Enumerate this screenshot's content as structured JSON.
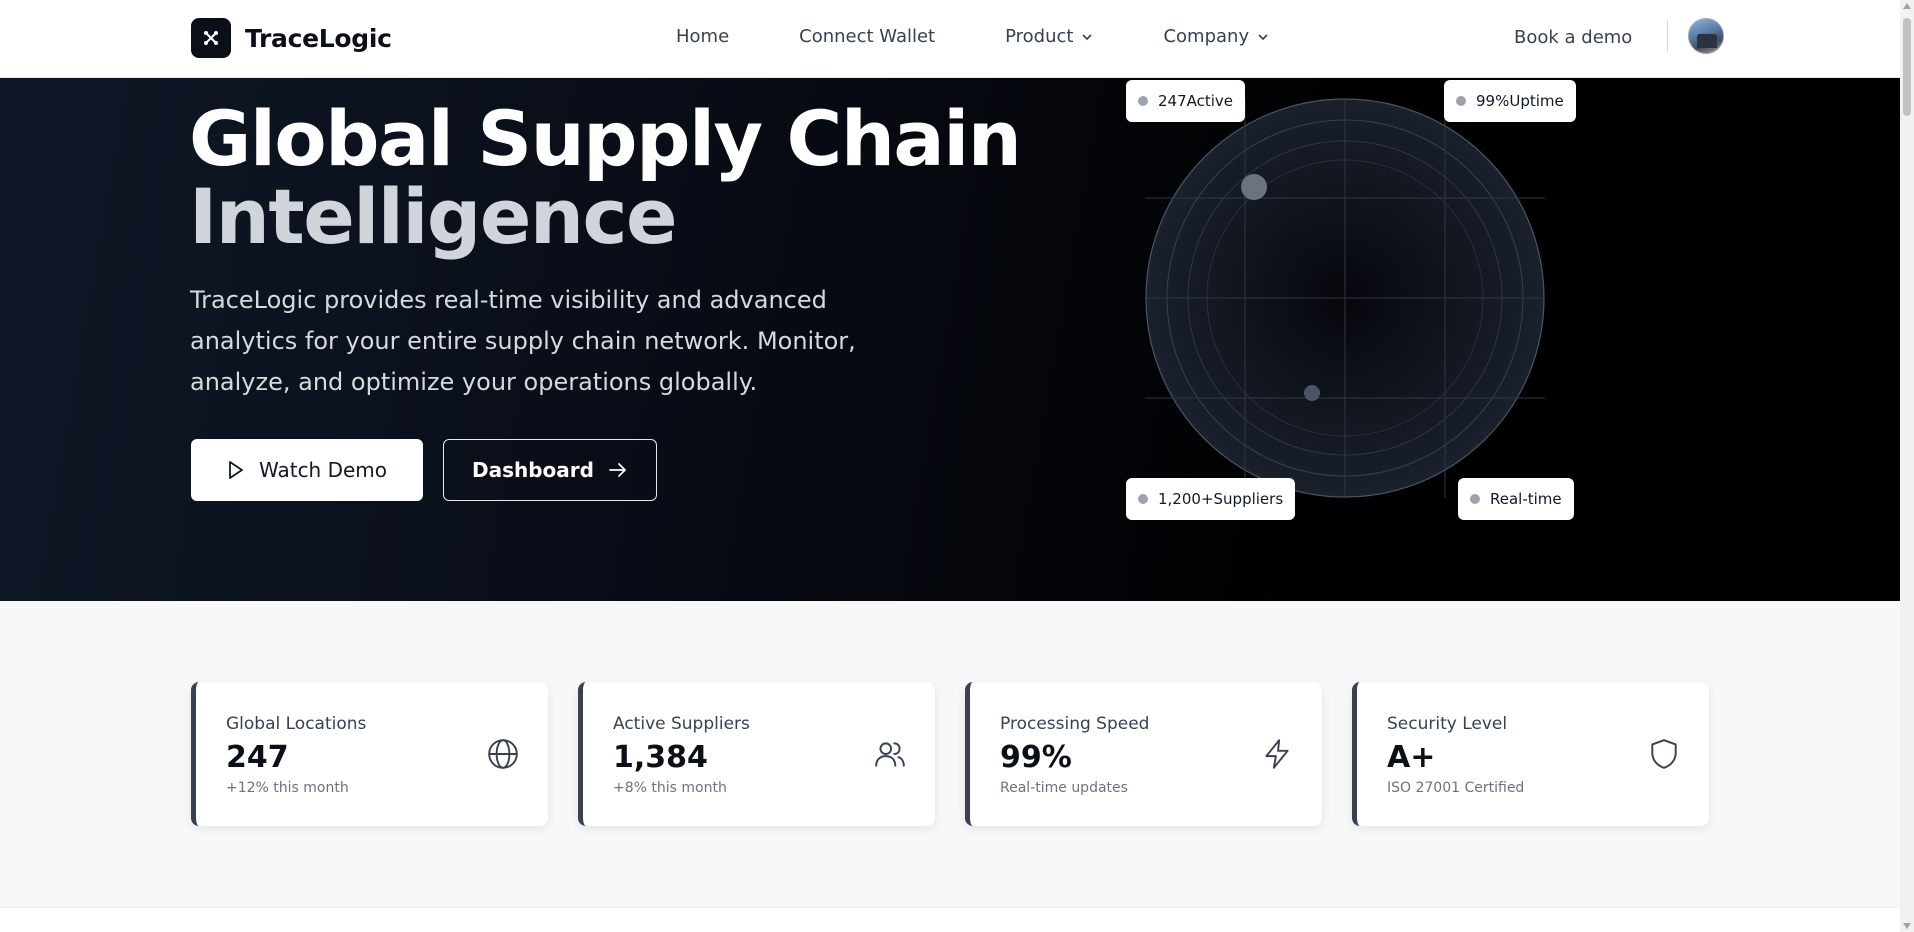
{
  "nav": {
    "brand": "TraceLogic",
    "links": [
      {
        "label": "Home",
        "dropdown": false
      },
      {
        "label": "Connect Wallet",
        "dropdown": false
      },
      {
        "label": "Product",
        "dropdown": true
      },
      {
        "label": "Company",
        "dropdown": true
      }
    ],
    "cta": "Book a demo"
  },
  "hero": {
    "title_line1": "Global Supply Chain",
    "title_line2": "Intelligence",
    "description": "TraceLogic provides real-time visibility and advanced analytics for your entire supply chain network. Monitor, analyze, and optimize your operations globally.",
    "watch_demo": "Watch Demo",
    "dashboard": "Dashboard",
    "badges": [
      {
        "value": "247",
        "label": "Active"
      },
      {
        "value": "99%",
        "label": "Uptime"
      },
      {
        "value": "1,200+",
        "label": "Suppliers"
      },
      {
        "value": "",
        "label": "Real-time"
      }
    ]
  },
  "stats": [
    {
      "label": "Global Locations",
      "value": "247",
      "sub": "+12% this month",
      "icon": "globe-icon"
    },
    {
      "label": "Active Suppliers",
      "value": "1,384",
      "sub": "+8% this month",
      "icon": "users-icon"
    },
    {
      "label": "Processing Speed",
      "value": "99%",
      "sub": "Real-time updates",
      "icon": "lightning-icon"
    },
    {
      "label": "Security Level",
      "value": "A+",
      "sub": "ISO 27001 Certified",
      "icon": "shield-icon"
    }
  ],
  "colors": {
    "hero_dark": "#000000",
    "accent_border": "#374151",
    "text_primary": "#111827"
  }
}
